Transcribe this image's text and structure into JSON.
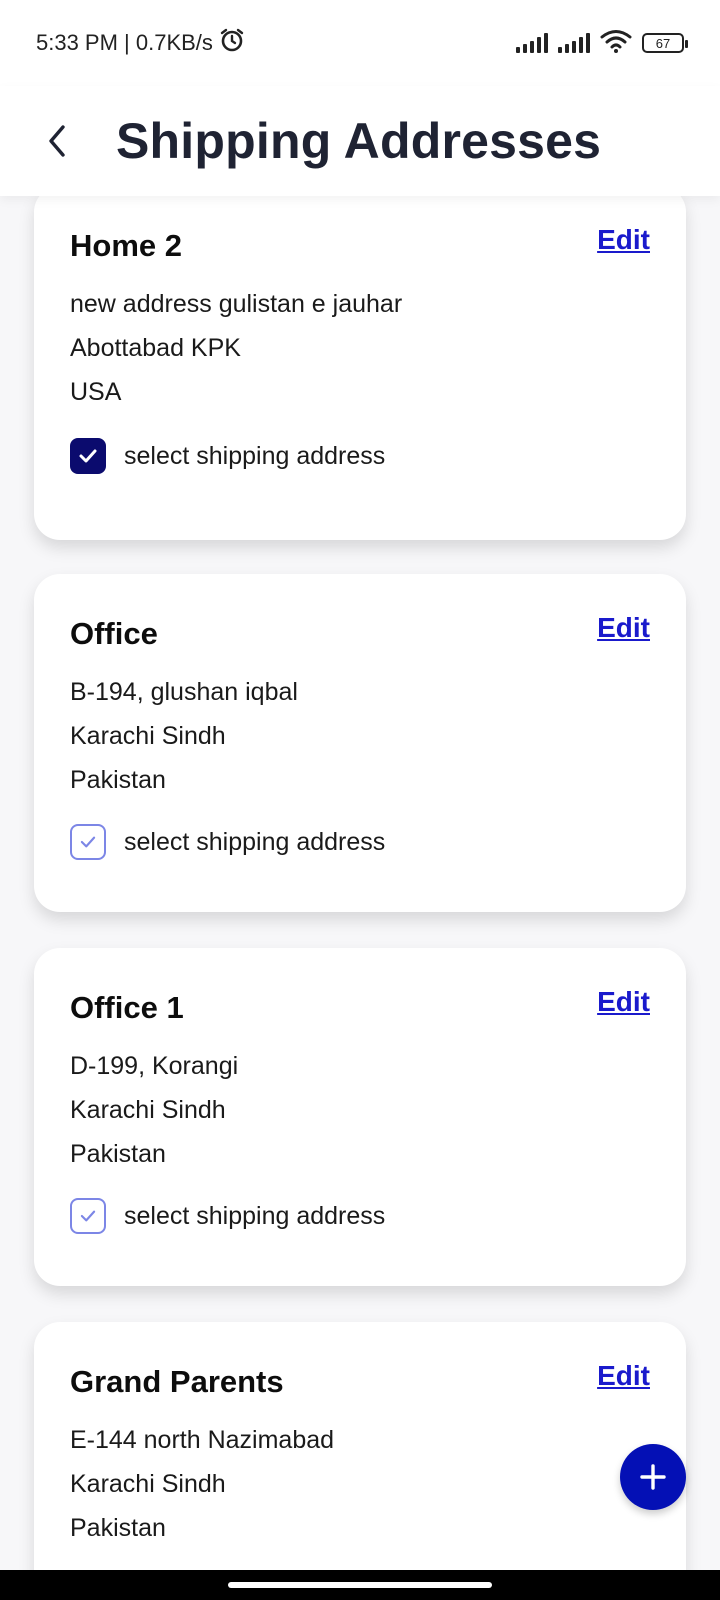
{
  "status_bar": {
    "time_speed": "5:33 PM | 0.7KB/s",
    "battery": "67"
  },
  "header": {
    "title": "Shipping Addresses"
  },
  "addresses": [
    {
      "name": "Home 2",
      "edit_label": "Edit",
      "line1": "new address gulistan e jauhar",
      "line2": "Abottabad KPK",
      "line3": "USA",
      "select_label": "select shipping address",
      "selected": true
    },
    {
      "name": "Office",
      "edit_label": "Edit",
      "line1": "B-194, glushan iqbal",
      "line2": "Karachi Sindh",
      "line3": "Pakistan",
      "select_label": "select shipping address",
      "selected": false
    },
    {
      "name": "Office 1",
      "edit_label": "Edit",
      "line1": "D-199, Korangi",
      "line2": "Karachi Sindh",
      "line3": "Pakistan",
      "select_label": "select shipping address",
      "selected": false
    },
    {
      "name": "Grand Parents",
      "edit_label": "Edit",
      "line1": "E-144 north Nazimabad",
      "line2": "Karachi Sindh",
      "line3": "Pakistan"
    }
  ],
  "colors": {
    "accent": "#0410b5",
    "checkbox_checked": "#0b0b6e",
    "checkbox_unchecked_border": "#7c86e6",
    "link": "#1a1acc",
    "title": "#1f2333"
  },
  "icons": {
    "back": "chevron-left-icon",
    "alarm": "alarm-icon",
    "signal": "signal-icon",
    "wifi": "wifi-icon",
    "battery": "battery-icon",
    "add": "plus-icon",
    "check": "check-icon"
  }
}
